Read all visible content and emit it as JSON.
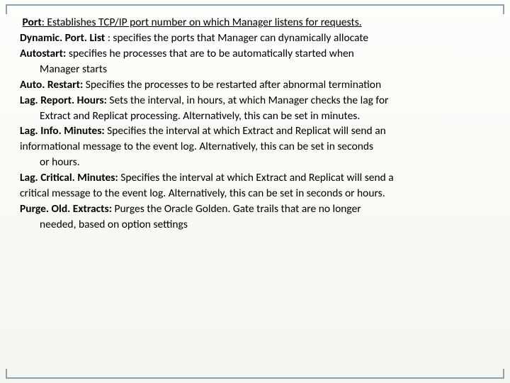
{
  "items": [
    {
      "term": "Port",
      "sep": ": ",
      "desc": "Establishes TCP/IP port number on which Manager listens for requests.",
      "hang": false,
      "first": true,
      "leadSpace": true
    },
    {
      "term": "Dynamic. Port. List",
      "sep": " : ",
      "desc": "specifies the ports that Manager can dynamically allocate",
      "hang": false
    },
    {
      "term": "Autostart:",
      "sep": " ",
      "desc": "specifies he processes that are to be automatically started when",
      "hang": false
    },
    {
      "term": "",
      "sep": "",
      "desc": "Manager starts",
      "hang": true
    },
    {
      "term": "Auto. Restart:",
      "sep": " ",
      "desc": "Specifies the processes to be restarted after abnormal termination",
      "hang": false
    },
    {
      "term": "Lag. Report. Hours:",
      "sep": " ",
      "desc": "Sets the interval, in hours, at which Manager checks the lag for",
      "hang": false
    },
    {
      "term": "",
      "sep": "",
      "desc": "Extract and Replicat processing. Alternatively, this can be set in minutes.",
      "hang": true
    },
    {
      "term": "Lag. Info. Minutes:",
      "sep": " ",
      "desc": "Specifies the interval at which Extract and Replicat will send an",
      "hang": false
    },
    {
      "term": "",
      "sep": "",
      "desc": "informational message to the event log. Alternatively, this can be set in seconds",
      "hang": false
    },
    {
      "term": "",
      "sep": "",
      "desc": "or hours.",
      "hang": true
    },
    {
      "term": "Lag. Critical. Minutes:",
      "sep": " ",
      "desc": "Specifies the interval at which Extract and Replicat will send a",
      "hang": false
    },
    {
      "term": "",
      "sep": "",
      "desc": "critical message to the event log. Alternatively, this can be set in seconds or hours.",
      "hang": false
    },
    {
      "term": "Purge. Old. Extracts:",
      "sep": " ",
      "desc": "Purges the Oracle Golden. Gate trails that are no longer",
      "hang": false
    },
    {
      "term": "",
      "sep": "",
      "desc": "needed, based on option settings",
      "hang": true
    }
  ]
}
